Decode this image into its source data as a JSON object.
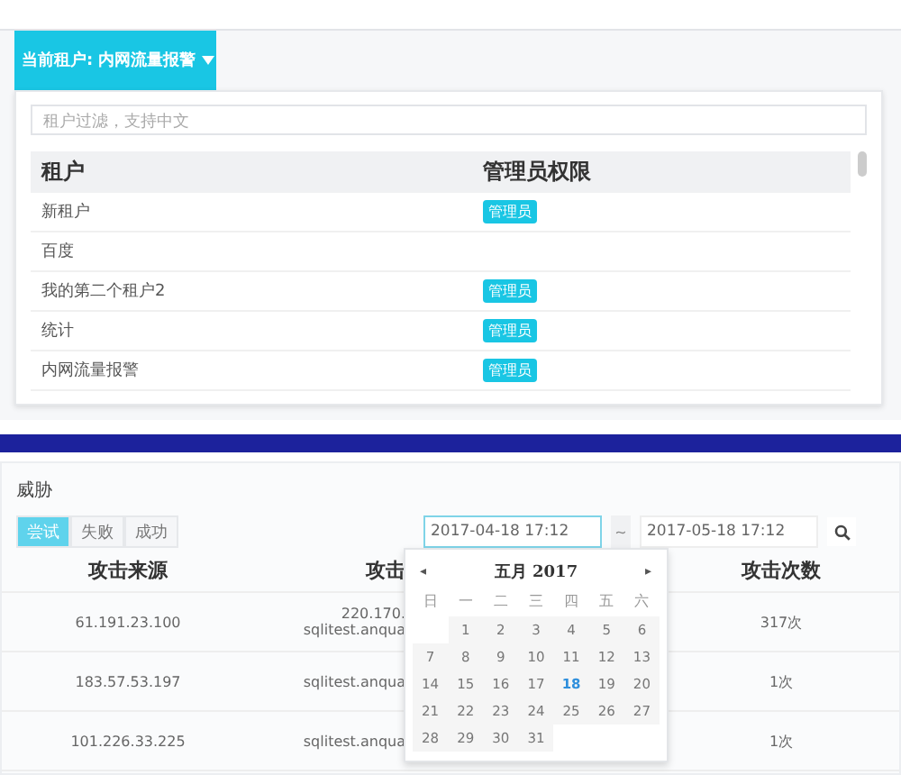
{
  "tenant_panel": {
    "switcher": {
      "label": "当前租户: 内网流量报警"
    },
    "filter": {
      "placeholder": "租户过滤，支持中文"
    },
    "columns": [
      "租户",
      "管理员权限"
    ],
    "rows": [
      {
        "name": "新租户",
        "admin": true,
        "badge": "管理员"
      },
      {
        "name": "百度",
        "admin": false
      },
      {
        "name": "我的第二个租户2",
        "admin": true,
        "badge": "管理员"
      },
      {
        "name": "统计",
        "admin": true,
        "badge": "管理员"
      },
      {
        "name": "内网流量报警",
        "admin": true,
        "badge": "管理员"
      }
    ]
  },
  "threat_panel": {
    "title": "威胁",
    "tabs": [
      {
        "label": "尝试",
        "selected": true
      },
      {
        "label": "失败",
        "selected": false
      },
      {
        "label": "成功",
        "selected": false
      }
    ],
    "date_from": "2017-04-18 17:12",
    "separator": "~",
    "date_to": "2017-05-18 17:12",
    "columns": [
      "攻击来源",
      "攻击",
      "攻击次数"
    ],
    "rows": [
      {
        "source": "61.191.23.100",
        "target": [
          "220.170.",
          "sqlitest.anqua"
        ],
        "count": "317次"
      },
      {
        "source": "183.57.53.197",
        "target": [
          "sqlitest.anqua"
        ],
        "count": "1次"
      },
      {
        "source": "101.226.33.225",
        "target": [
          "sqlitest.anqua"
        ],
        "count": "1次"
      }
    ],
    "calendar": {
      "prev": "◂",
      "month": "五月",
      "year": "2017",
      "next": "▸",
      "weekdays": [
        "日",
        "一",
        "二",
        "三",
        "四",
        "五",
        "六"
      ],
      "weeks": [
        [
          {
            "label": "1",
            "selected": false
          },
          {
            "label": "2",
            "selected": false
          },
          {
            "label": "3",
            "selected": false
          },
          {
            "label": "4",
            "selected": false
          },
          {
            "label": "5",
            "selected": false
          },
          {
            "label": "6",
            "selected": false
          }
        ],
        [
          {
            "label": "7",
            "selected": false
          },
          {
            "label": "8",
            "selected": false
          },
          {
            "label": "9",
            "selected": false
          },
          {
            "label": "10",
            "selected": false
          },
          {
            "label": "11",
            "selected": false
          },
          {
            "label": "12",
            "selected": false
          },
          {
            "label": "13",
            "selected": false
          }
        ],
        [
          {
            "label": "14",
            "selected": false
          },
          {
            "label": "15",
            "selected": false
          },
          {
            "label": "16",
            "selected": false
          },
          {
            "label": "17",
            "selected": false
          },
          {
            "label": "18",
            "selected": true
          },
          {
            "label": "19",
            "selected": false
          },
          {
            "label": "20",
            "selected": false
          }
        ],
        [
          {
            "label": "21",
            "selected": false
          },
          {
            "label": "22",
            "selected": false
          },
          {
            "label": "23",
            "selected": false
          },
          {
            "label": "24",
            "selected": false
          },
          {
            "label": "25",
            "selected": false
          },
          {
            "label": "26",
            "selected": false
          },
          {
            "label": "27",
            "selected": false
          }
        ],
        [
          {
            "label": "28",
            "selected": false
          },
          {
            "label": "29",
            "selected": false
          },
          {
            "label": "30",
            "selected": false
          },
          {
            "label": "31",
            "selected": false
          }
        ]
      ]
    }
  }
}
